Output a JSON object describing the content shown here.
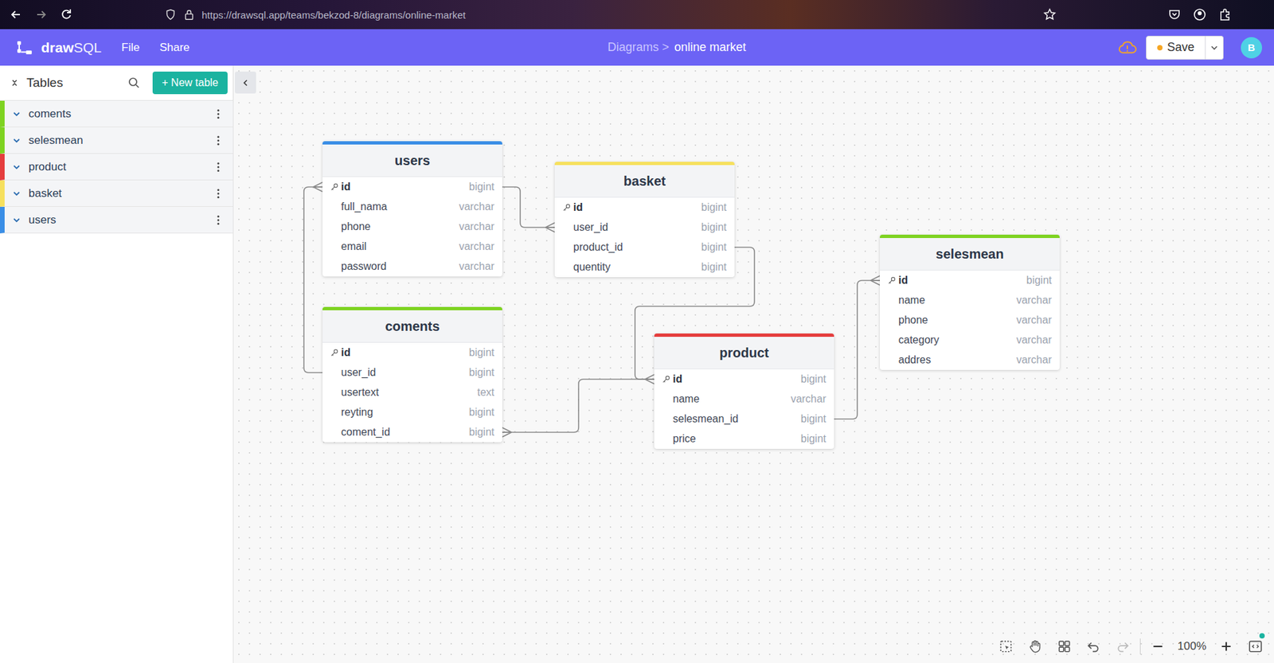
{
  "browser": {
    "url": "https://drawsql.app/teams/bekzod-8/diagrams/online-market"
  },
  "app": {
    "logo": {
      "bold": "draw",
      "light": "SQL"
    },
    "menu": [
      "File",
      "Share"
    ],
    "breadcrumb": {
      "parent": "Diagrams >",
      "current": "online market"
    },
    "save": {
      "label": "Save",
      "unsaved": true
    },
    "avatar": "B"
  },
  "sidebar": {
    "title": "Tables",
    "new_button": "+ New table",
    "tables": [
      {
        "name": "coments",
        "color": "#7ed321"
      },
      {
        "name": "selesmean",
        "color": "#7ed321"
      },
      {
        "name": "product",
        "color": "#e53e3e"
      },
      {
        "name": "basket",
        "color": "#f6e05e"
      },
      {
        "name": "users",
        "color": "#3a8ee6"
      }
    ]
  },
  "diagram": {
    "tables": [
      {
        "name": "users",
        "color": "#3a8ee6",
        "columns": [
          {
            "name": "id",
            "type": "bigint",
            "primary": true
          },
          {
            "name": "full_nama",
            "type": "varchar",
            "primary": false
          },
          {
            "name": "phone",
            "type": "varchar",
            "primary": false
          },
          {
            "name": "email",
            "type": "varchar",
            "primary": false
          },
          {
            "name": "password",
            "type": "varchar",
            "primary": false
          }
        ]
      },
      {
        "name": "basket",
        "color": "#f6e05e",
        "columns": [
          {
            "name": "id",
            "type": "bigint",
            "primary": true
          },
          {
            "name": "user_id",
            "type": "bigint",
            "primary": false
          },
          {
            "name": "product_id",
            "type": "bigint",
            "primary": false
          },
          {
            "name": "quentity",
            "type": "bigint",
            "primary": false
          }
        ]
      },
      {
        "name": "coments",
        "color": "#7ed321",
        "columns": [
          {
            "name": "id",
            "type": "bigint",
            "primary": true
          },
          {
            "name": "user_id",
            "type": "bigint",
            "primary": false
          },
          {
            "name": "usertext",
            "type": "text",
            "primary": false
          },
          {
            "name": "reyting",
            "type": "bigint",
            "primary": false
          },
          {
            "name": "coment_id",
            "type": "bigint",
            "primary": false
          }
        ]
      },
      {
        "name": "product",
        "color": "#e53e3e",
        "columns": [
          {
            "name": "id",
            "type": "bigint",
            "primary": true
          },
          {
            "name": "name",
            "type": "varchar",
            "primary": false
          },
          {
            "name": "selesmean_id",
            "type": "bigint",
            "primary": false
          },
          {
            "name": "price",
            "type": "bigint",
            "primary": false
          }
        ]
      },
      {
        "name": "selesmean",
        "color": "#7ed321",
        "columns": [
          {
            "name": "id",
            "type": "bigint",
            "primary": true
          },
          {
            "name": "name",
            "type": "varchar",
            "primary": false
          },
          {
            "name": "phone",
            "type": "varchar",
            "primary": false
          },
          {
            "name": "category",
            "type": "varchar",
            "primary": false
          },
          {
            "name": "addres",
            "type": "varchar",
            "primary": false
          }
        ]
      }
    ],
    "relations": [
      {
        "from": {
          "table": "users",
          "column": "id"
        },
        "to": {
          "table": "basket",
          "column": "user_id"
        }
      },
      {
        "from": {
          "table": "coments",
          "column": "user_id"
        },
        "to": {
          "table": "users",
          "column": "id"
        }
      },
      {
        "from": {
          "table": "basket",
          "column": "product_id"
        },
        "to": {
          "table": "product",
          "column": "id"
        }
      },
      {
        "from": {
          "table": "product",
          "column": "id"
        },
        "to": {
          "table": "coments",
          "column": "coment_id"
        }
      },
      {
        "from": {
          "table": "product",
          "column": "selesmean_id"
        },
        "to": {
          "table": "selesmean",
          "column": "id"
        }
      }
    ]
  },
  "zoom": "100%"
}
